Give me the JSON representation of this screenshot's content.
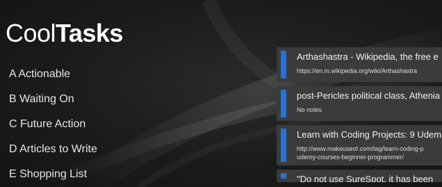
{
  "app": {
    "title_light": "Cool",
    "title_bold": "Tasks",
    "accent_color": "#1f72e0"
  },
  "categories": [
    {
      "label": "A Actionable"
    },
    {
      "label": "B Waiting On"
    },
    {
      "label": "C Future Action"
    },
    {
      "label": "D Articles to Write"
    },
    {
      "label": "E Shopping List"
    }
  ],
  "tasks": [
    {
      "title": "Arthashastra - Wikipedia, the free e",
      "sub": "https://en.m.wikipedia.org/wiki/Arthashastra"
    },
    {
      "title": "post-Pericles political class, Athenia",
      "sub": "No notes"
    },
    {
      "title": "Learn with Coding Projects: 9 Udem",
      "sub": "http://www.makeuseof.com/tag/learn-coding-p",
      "sub2": "udemy-courses-beginner-programmer/"
    },
    {
      "title": "\"Do not use SureSpot, it has been"
    }
  ]
}
